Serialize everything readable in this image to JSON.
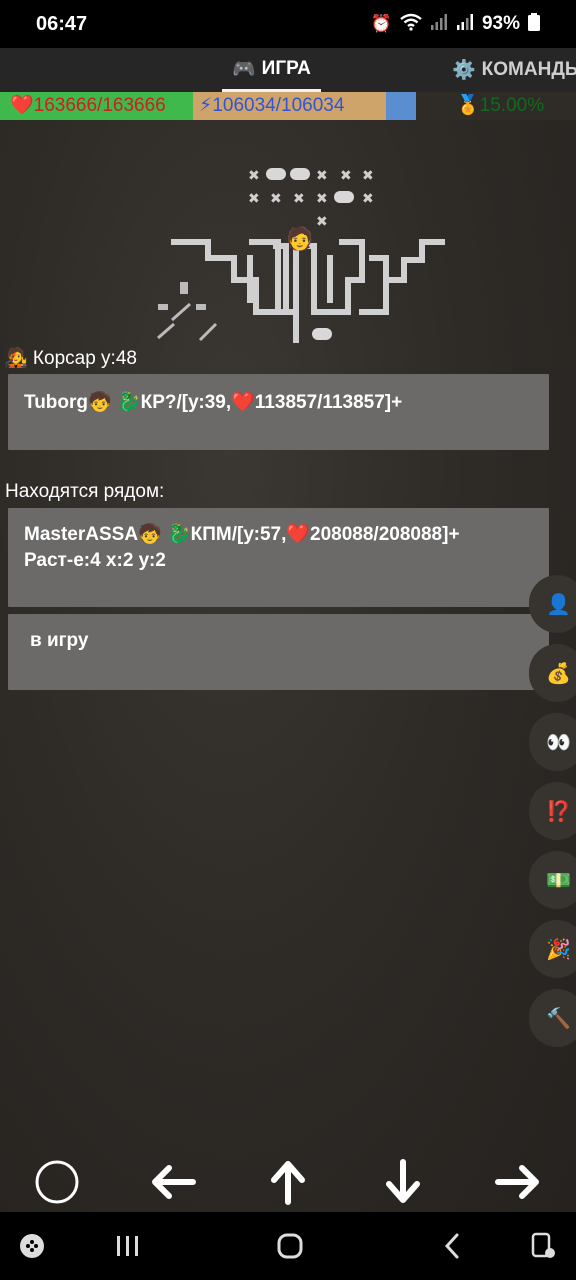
{
  "status_bar": {
    "time": "06:47",
    "battery": "93%",
    "icons": [
      "alarm-icon",
      "wifi-icon",
      "signal-icon",
      "signal-icon",
      "battery-icon"
    ]
  },
  "tabs": [
    {
      "label": "ИГРА",
      "icon": "gamepad-icon",
      "active": true
    },
    {
      "label": "КОМАНДЫ",
      "icon": "gear-icon",
      "active": false
    }
  ],
  "stats": {
    "hp": "❤️163666/163666",
    "energy": "⚡106034/106034",
    "xp": "🏅15.00%"
  },
  "player": {
    "line": "🧑‍🎤 Корсар  у:48"
  },
  "target": {
    "text": "Tuborg🧒 🐉КР?/[у:39,❤️113857/113857]+"
  },
  "nearby": {
    "heading": "Находятся рядом:",
    "line1": "MasterASSA🧒 🐉КПМ/[у:57,❤️208088/208088]+",
    "line2": "Раст-е:4 х:2 у:2"
  },
  "action": {
    "label": "в игру"
  },
  "side_buttons": [
    {
      "icon": "person-icon",
      "glyph": "👤"
    },
    {
      "icon": "money-bag-icon",
      "glyph": "💰"
    },
    {
      "icon": "eyes-icon",
      "glyph": "👀"
    },
    {
      "icon": "exclamation-question-icon",
      "glyph": "⁉️"
    },
    {
      "icon": "banknote-icon",
      "glyph": "💵"
    },
    {
      "icon": "party-popper-icon",
      "glyph": "🎉"
    },
    {
      "icon": "hammer-icon",
      "glyph": "🔨"
    }
  ],
  "controls": [
    "circle-button",
    "arrow-left",
    "arrow-up",
    "arrow-down",
    "arrow-right"
  ],
  "colors": {
    "hp_bg": "#3fb84c",
    "hp_text": "#d41c1c",
    "energy_bg": "#cfa46a",
    "energy_text": "#2f54d8",
    "card_bg": "#6b6a69"
  }
}
